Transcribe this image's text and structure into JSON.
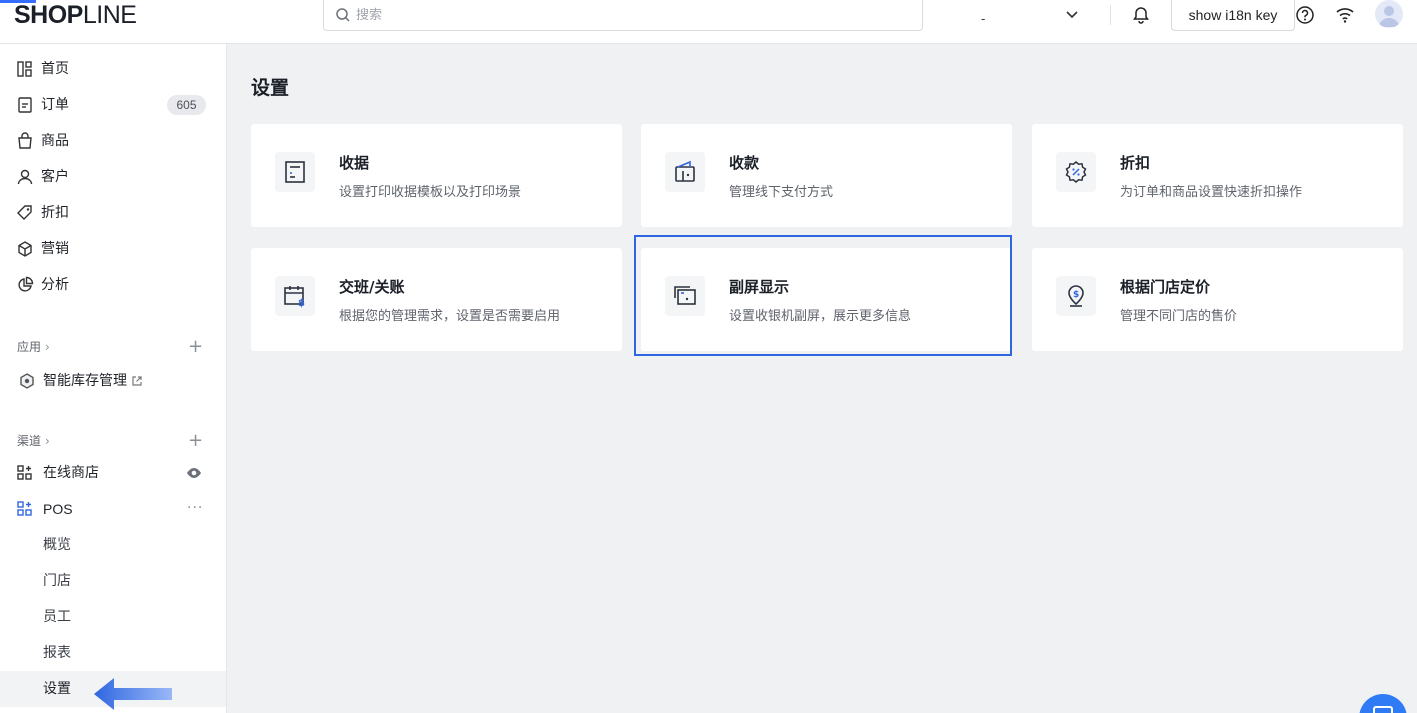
{
  "header": {
    "logo_bold": "SHOP",
    "logo_thin": "LINE",
    "search_placeholder": "搜索",
    "store_name": "-",
    "i18n_button": "show i18n key"
  },
  "sidebar": {
    "items": [
      {
        "label": "首页",
        "icon": "home-icon"
      },
      {
        "label": "订单",
        "icon": "order-icon",
        "badge": "605"
      },
      {
        "label": "商品",
        "icon": "product-icon"
      },
      {
        "label": "客户",
        "icon": "customer-icon"
      },
      {
        "label": "折扣",
        "icon": "tag-icon"
      },
      {
        "label": "营销",
        "icon": "marketing-icon"
      },
      {
        "label": "分析",
        "icon": "analytics-icon"
      }
    ],
    "apps_section": "应用",
    "apps": [
      {
        "label": "智能库存管理",
        "icon": "inventory-icon"
      }
    ],
    "channels_section": "渠道",
    "channels": [
      {
        "label": "在线商店",
        "icon": "store-icon"
      },
      {
        "label": "POS",
        "icon": "pos-icon"
      }
    ],
    "pos_sub": [
      "概览",
      "门店",
      "员工",
      "报表",
      "设置"
    ]
  },
  "main": {
    "title": "设置",
    "cards": [
      {
        "title": "收据",
        "desc": "设置打印收据模板以及打印场景",
        "icon": "receipt-icon"
      },
      {
        "title": "收款",
        "desc": "管理线下支付方式",
        "icon": "wallet-icon"
      },
      {
        "title": "折扣",
        "desc": "为订单和商品设置快速折扣操作",
        "icon": "discount-icon"
      },
      {
        "title": "交班/关账",
        "desc": "根据您的管理需求，设置是否需要启用",
        "icon": "shift-calendar-icon"
      },
      {
        "title": "副屏显示",
        "desc": "设置收银机副屏，展示更多信息",
        "icon": "second-screen-icon"
      },
      {
        "title": "根据门店定价",
        "desc": "管理不同门店的售价",
        "icon": "location-price-icon"
      }
    ]
  },
  "colors": {
    "accent": "#2f66e0",
    "arrow": "#4a7cf0"
  }
}
